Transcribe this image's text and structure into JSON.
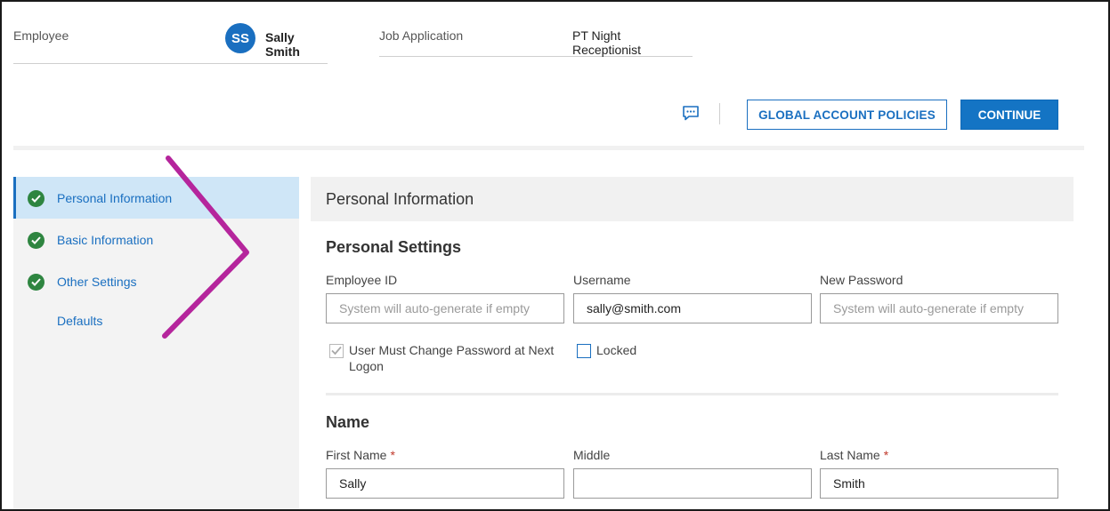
{
  "header": {
    "employee_label": "Employee",
    "avatar_initials": "SS",
    "employee_name": "Sally Smith",
    "job_label": "Job Application",
    "job_title": "PT Night Receptionist"
  },
  "toolbar": {
    "global_policies_label": "GLOBAL ACCOUNT POLICIES",
    "continue_label": "CONTINUE"
  },
  "sidebar": {
    "items": [
      {
        "label": "Personal Information",
        "complete": true,
        "active": true
      },
      {
        "label": "Basic Information",
        "complete": true,
        "active": false
      },
      {
        "label": "Other Settings",
        "complete": true,
        "active": false
      },
      {
        "label": "Defaults",
        "complete": false,
        "active": false
      }
    ]
  },
  "main": {
    "section_title": "Personal Information",
    "personal_settings": {
      "title": "Personal Settings",
      "employee_id_label": "Employee ID",
      "employee_id_placeholder": "System will auto-generate if empty",
      "employee_id_value": "",
      "username_label": "Username",
      "username_value": "sally@smith.com",
      "new_password_label": "New Password",
      "new_password_placeholder": "System will auto-generate if empty",
      "must_change_label": "User Must Change Password at Next Logon",
      "must_change_checked": true,
      "locked_label": "Locked",
      "locked_checked": false
    },
    "name": {
      "title": "Name",
      "first_label": "First Name",
      "first_value": "Sally",
      "middle_label": "Middle",
      "middle_value": "",
      "last_label": "Last Name",
      "last_value": "Smith",
      "required_mark": "*"
    }
  },
  "colors": {
    "accent": "#1a6fc0",
    "success": "#2e8540",
    "annotation": "#b5259c"
  },
  "icons": {
    "message": "chat-bubble-icon",
    "complete": "check-circle-icon"
  }
}
